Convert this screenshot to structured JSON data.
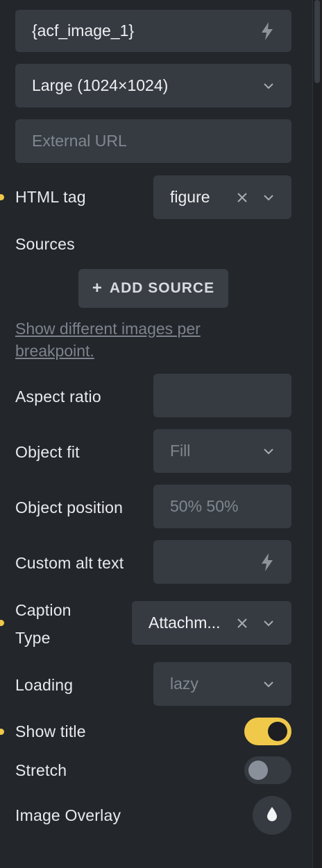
{
  "image_field": {
    "value": "{acf_image_1}",
    "icon": "bolt-icon"
  },
  "size_select": {
    "value": "Large (1024×1024)",
    "icon": "chevron-down-icon"
  },
  "external_url": {
    "placeholder": "External URL"
  },
  "html_tag": {
    "label": "HTML tag",
    "value": "figure",
    "modified": true
  },
  "sources": {
    "label": "Sources",
    "add_button": "ADD SOURCE",
    "help_link": "Show different images per breakpoint."
  },
  "aspect_ratio": {
    "label": "Aspect ratio",
    "value": ""
  },
  "object_fit": {
    "label": "Object fit",
    "placeholder": "Fill"
  },
  "object_position": {
    "label": "Object position",
    "placeholder": "50% 50%"
  },
  "custom_alt": {
    "label": "Custom alt text",
    "value": ""
  },
  "caption_type": {
    "label_line1": "Caption",
    "label_line2": "Type",
    "value": "Attachm...",
    "modified": true
  },
  "loading": {
    "label": "Loading",
    "placeholder": "lazy"
  },
  "show_title": {
    "label": "Show title",
    "on": true,
    "modified": true
  },
  "stretch": {
    "label": "Stretch",
    "on": false
  },
  "image_overlay": {
    "label": "Image Overlay",
    "icon": "droplet-icon"
  },
  "colors": {
    "accent": "#f0c94a",
    "panel_bg": "#23262b",
    "field_bg": "#363b42",
    "toggle_off_track": "#363b42",
    "toggle_off_knob": "#8a9099"
  }
}
